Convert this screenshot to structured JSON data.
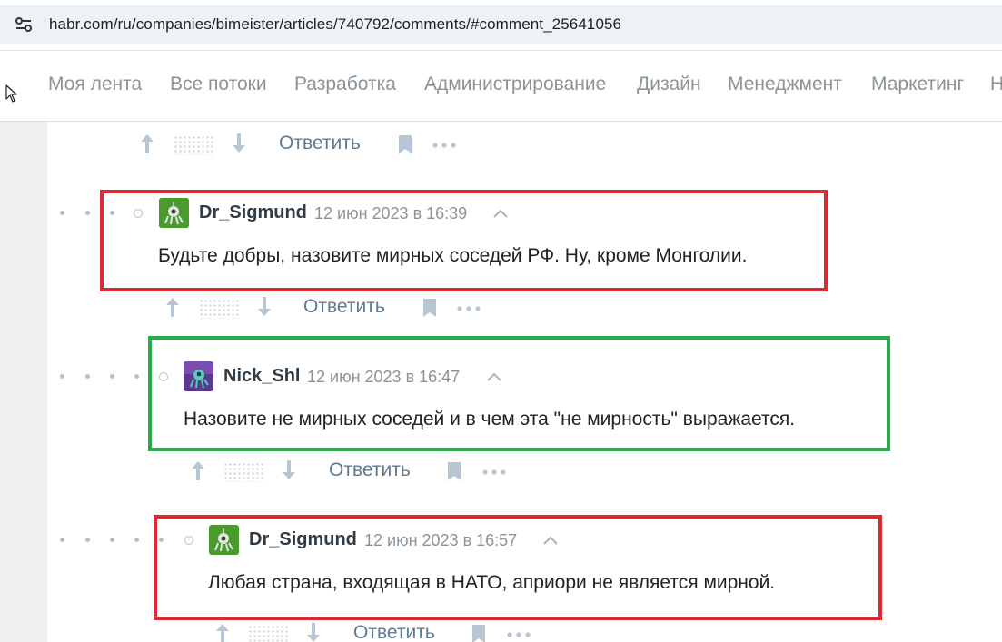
{
  "browser": {
    "url": "habr.com/ru/companies/bimeister/articles/740792/comments/#comment_25641056"
  },
  "nav": {
    "items": [
      "Моя лента",
      "Все потоки",
      "Разработка",
      "Администрирование",
      "Дизайн",
      "Менеджмент",
      "Маркетинг",
      "Н"
    ]
  },
  "actions": {
    "reply_label": "Ответить"
  },
  "comments": [
    {
      "author": "Dr_Sigmund",
      "date": "12 июн 2023 в 16:39",
      "text": "Будьте добры, назовите мирных соседей РФ. Ну, кроме Монголии.",
      "highlight": "#dc2a35"
    },
    {
      "author": "Nick_Shl",
      "date": "12 июн 2023 в 16:47",
      "text": "Назовите не мирных соседей и в чем эта \"не мирность\" выражается.",
      "highlight": "#2aa84a"
    },
    {
      "author": "Dr_Sigmund",
      "date": "12 июн 2023 в 16:57",
      "text": "Любая страна, входящая в НАТО, априори не является мирной.",
      "highlight": "#dc2a35"
    }
  ],
  "colors": {
    "link": "#5e7a91",
    "muted": "#8a9399",
    "icon": "#b7c6d2"
  }
}
